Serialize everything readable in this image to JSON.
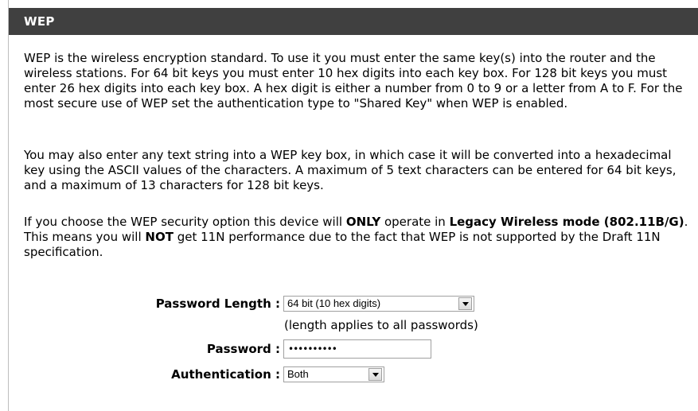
{
  "section": {
    "title": "WEP"
  },
  "paragraphs": {
    "p1": "WEP is the wireless encryption standard. To use it you must enter the same key(s) into the router and the wireless stations. For 64 bit keys you must enter 10 hex digits into each key box. For 128 bit keys you must enter 26 hex digits into each key box. A hex digit is either a number from 0 to 9 or a letter from A to F. For the most secure use of WEP set the authentication type to \"Shared Key\" when WEP is enabled.",
    "p2": "You may also enter any text string into a WEP key box, in which case it will be converted into a hexadecimal key using the ASCII values of the characters. A maximum of 5 text characters can be entered for 64 bit keys, and a maximum of 13 characters for 128 bit keys.",
    "p3": {
      "part1": "If you choose the WEP security option this device will ",
      "bold1": "ONLY",
      "part2": " operate in ",
      "bold2": "Legacy Wireless mode (802.11B/G)",
      "part3": ". This means you will ",
      "bold3": "NOT",
      "part4": " get 11N performance due to the fact that WEP is not supported by the Draft 11N specification."
    }
  },
  "form": {
    "password_length": {
      "label": "Password Length :",
      "selected": "64 bit (10 hex digits)",
      "note": "(length applies to all passwords)"
    },
    "password": {
      "label": "Password :",
      "value_masked": "••••••••••"
    },
    "authentication": {
      "label": "Authentication :",
      "selected": "Both"
    }
  },
  "colors": {
    "header_bg": "#404040",
    "header_text": "#ffffff",
    "border": "#a0a0a0"
  }
}
